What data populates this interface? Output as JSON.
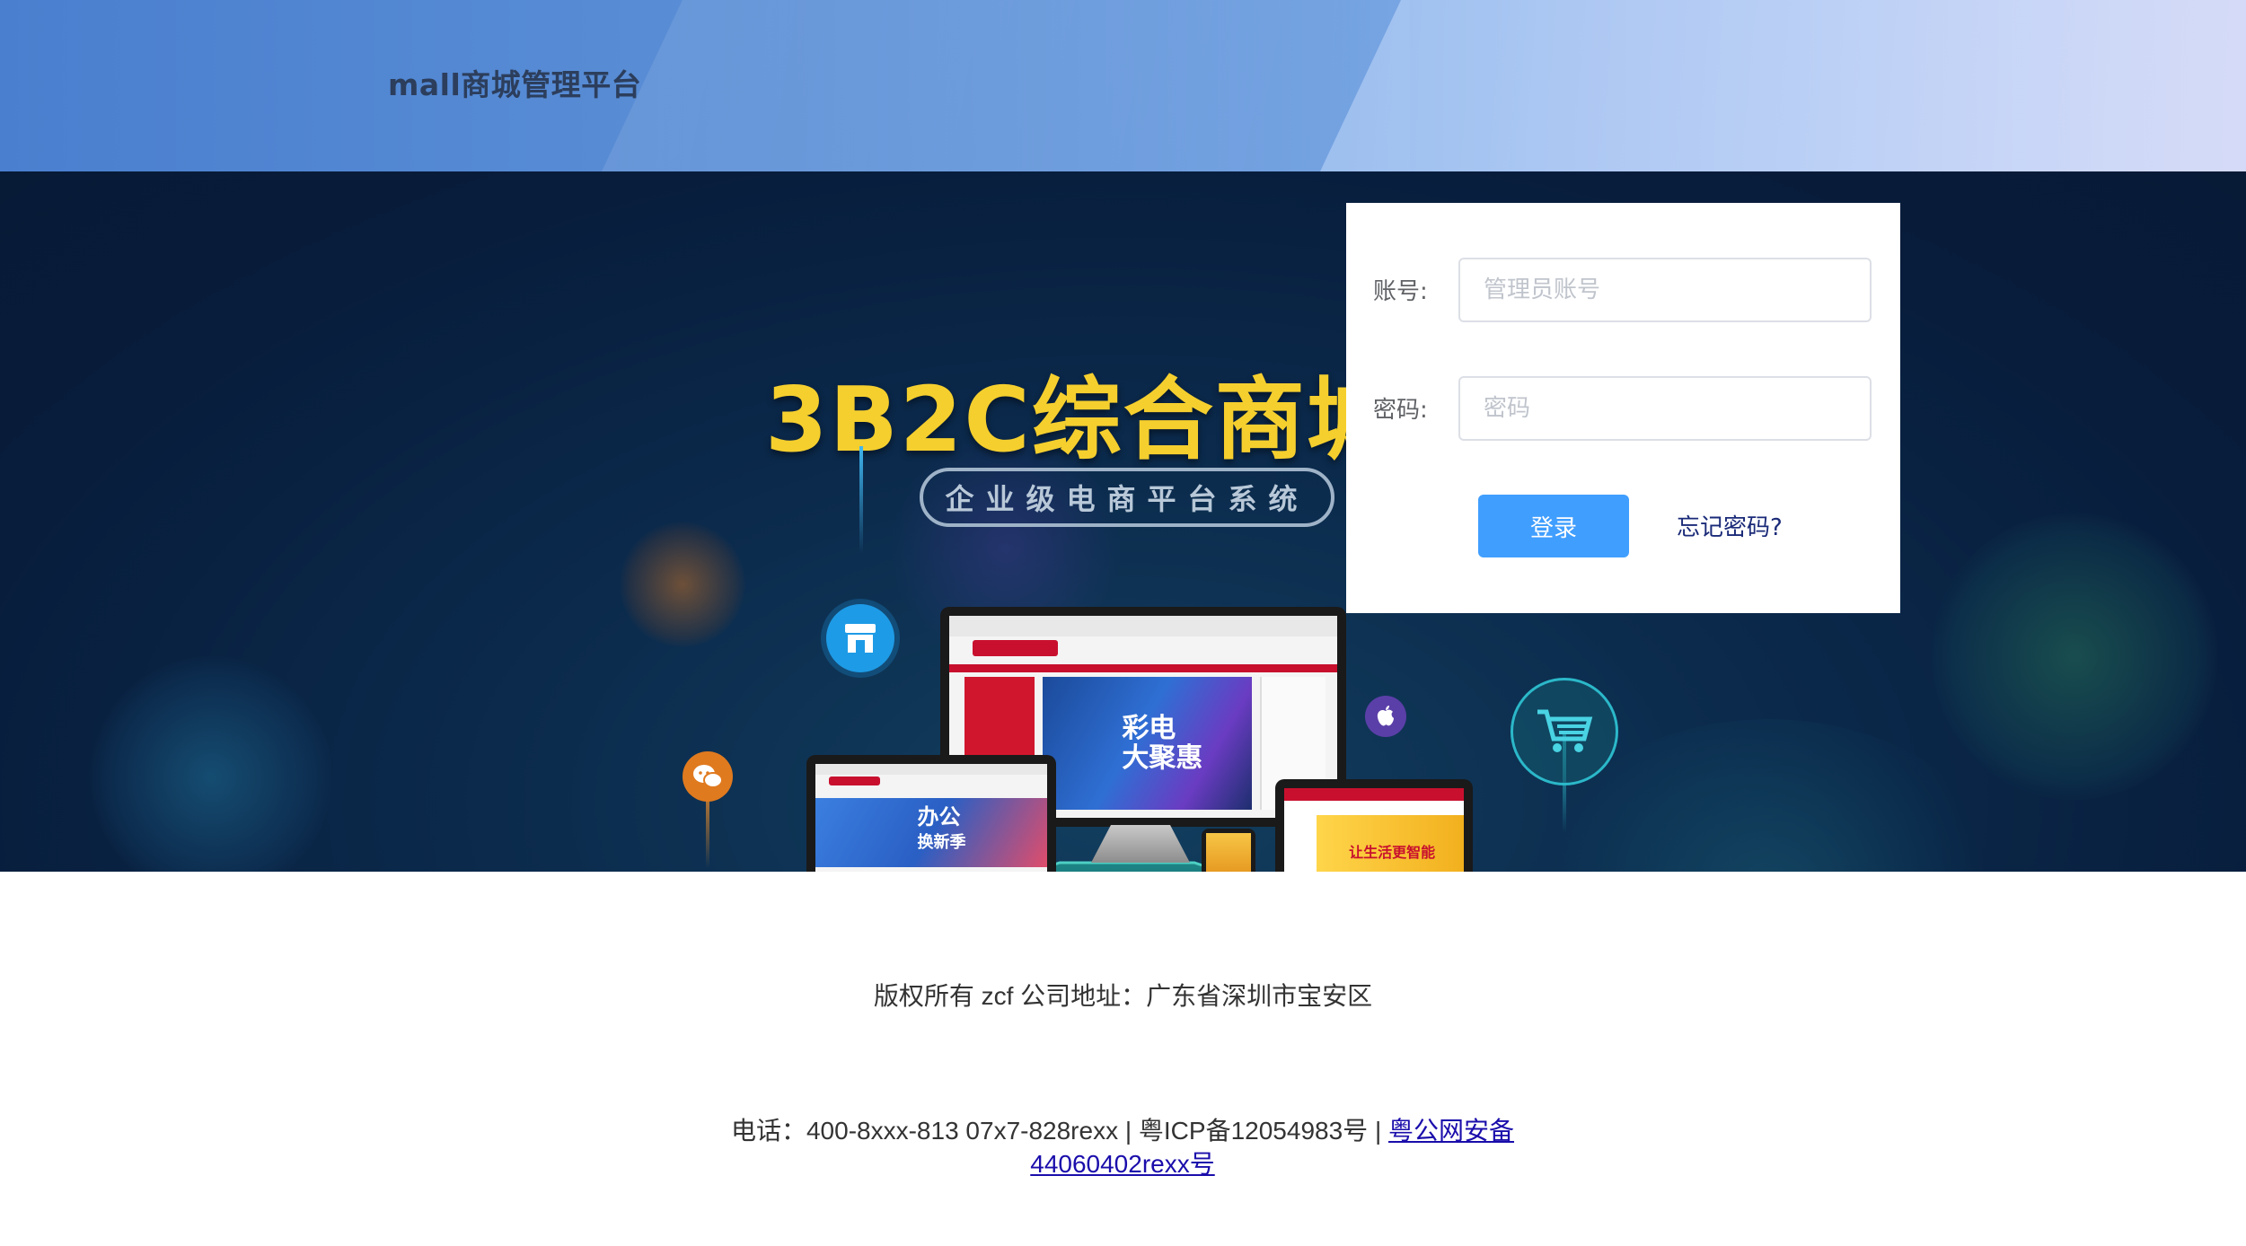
{
  "header": {
    "title": "mall商城管理平台"
  },
  "banner": {
    "headline": "3B2C综合商城系",
    "subtitle": "企业级电商平台系统",
    "promo_text_line1": "彩电",
    "promo_text_line2": "大聚惠",
    "tablet_text_line1": "办公",
    "tablet_text_line2": "换新季",
    "laptop_text": "让生活更智能",
    "colors": {
      "headline": "#f5cf2e",
      "banner_bg": "#081d3c"
    }
  },
  "login": {
    "account_label": "账号:",
    "account_placeholder": "管理员账号",
    "account_value": "",
    "password_label": "密码:",
    "password_placeholder": "密码",
    "password_value": "",
    "login_button": "登录",
    "forgot_link": "忘记密码?",
    "colors": {
      "button": "#409eff"
    }
  },
  "footer": {
    "copyright": "版权所有 zcf 公司地址：广东省深圳市宝安区",
    "contact_prefix": "电话：400-8xxx-813 07x7-828rexx | 粤ICP备12054983号 | ",
    "police_link": "粤公网安备44060402rexx号"
  },
  "icons": [
    "store-icon",
    "wechat-icon",
    "apple-icon",
    "cart-icon"
  ]
}
